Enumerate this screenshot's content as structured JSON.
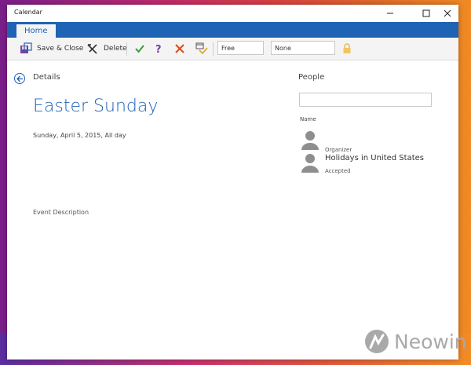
{
  "window": {
    "title": "Calendar"
  },
  "ribbon": {
    "active_tab": "Home"
  },
  "toolbar": {
    "save_close_label": "Save & Close",
    "delete_label": "Delete",
    "show_as_value": "Free",
    "reminder_value": "None"
  },
  "details": {
    "label": "Details",
    "title": "Easter Sunday",
    "date": "Sunday, April 5, 2015, All day",
    "description_placeholder": "Event Description"
  },
  "people": {
    "label": "People",
    "search_placeholder": "",
    "name_header": "Name",
    "entries": [
      {
        "name": "",
        "role": "Organizer"
      },
      {
        "name": "Holidays in United States",
        "role": "Accepted"
      }
    ]
  },
  "watermark": {
    "text": "Neowin"
  },
  "colors": {
    "accent": "#1f63b4",
    "accept": "#3a9a3a",
    "decline": "#e04a1a",
    "tentative": "#7b3fa0"
  }
}
